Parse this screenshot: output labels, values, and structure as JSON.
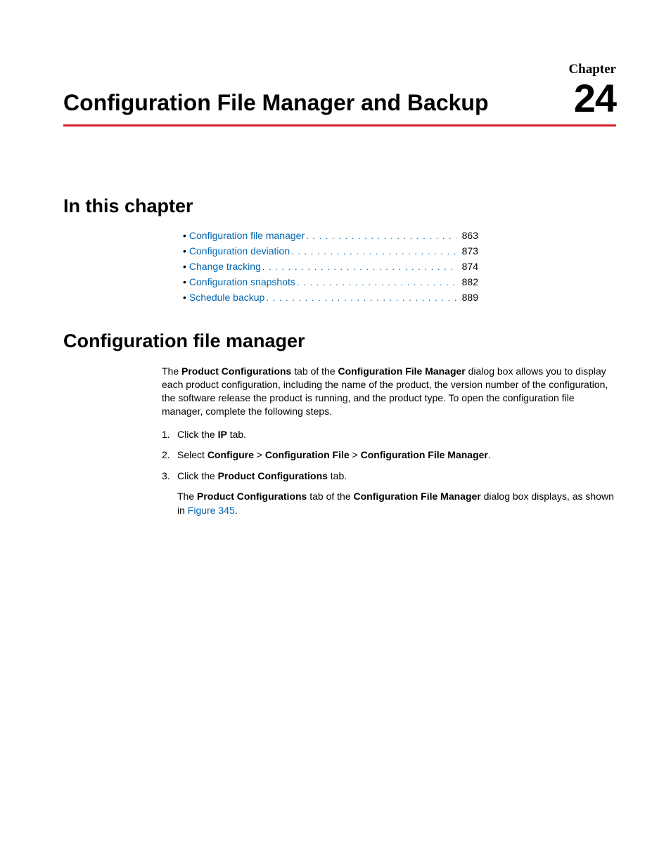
{
  "header": {
    "chapter_label": "Chapter",
    "chapter_number": "24",
    "title": "Configuration File Manager and Backup"
  },
  "toc": {
    "heading": "In this chapter",
    "items": [
      {
        "label": "Configuration file manager",
        "page": "863"
      },
      {
        "label": "Configuration deviation",
        "page": "873"
      },
      {
        "label": "Change tracking",
        "page": "874"
      },
      {
        "label": "Configuration snapshots",
        "page": "882"
      },
      {
        "label": "Schedule backup",
        "page": "889"
      }
    ]
  },
  "section": {
    "heading": "Configuration file manager",
    "intro_a": "The ",
    "intro_b": "Product Configurations",
    "intro_c": " tab of the ",
    "intro_d": "Configuration File Manager",
    "intro_e": " dialog box allows you to display each product configuration, including the name of the product, the version number of the configuration, the software release the product is running, and the product type. To open the configuration file manager, complete the following steps.",
    "step1_a": "Click the ",
    "step1_b": "IP",
    "step1_c": " tab.",
    "step2_a": "Select ",
    "step2_b": "Configure",
    "step2_c": " > ",
    "step2_d": "Configuration File",
    "step2_e": " > ",
    "step2_f": "Configuration File Manager",
    "step2_g": ".",
    "step3_a": "Click the ",
    "step3_b": "Product Configurations",
    "step3_c": " tab.",
    "sub_a": "The ",
    "sub_b": "Product Configurations",
    "sub_c": " tab of the ",
    "sub_d": "Configuration File Manager",
    "sub_e": " dialog box displays, as shown in ",
    "sub_f": "Figure 345",
    "sub_g": "."
  }
}
